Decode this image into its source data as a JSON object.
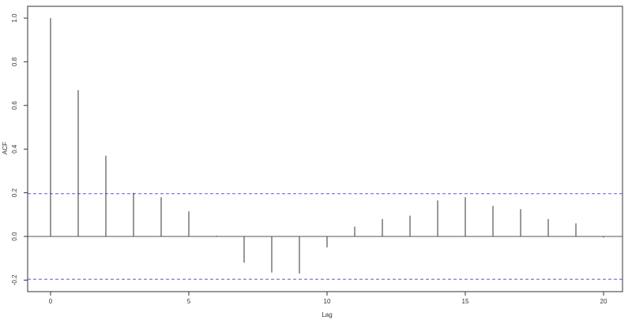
{
  "chart_data": {
    "type": "bar",
    "xlabel": "Lag",
    "ylabel": "ACF",
    "xlim": [
      -0.5,
      20.5
    ],
    "ylim": [
      -0.21,
      1.03
    ],
    "x": [
      0,
      1,
      2,
      3,
      4,
      5,
      6,
      7,
      8,
      9,
      10,
      11,
      12,
      13,
      14,
      15,
      16,
      17,
      18,
      19,
      20
    ],
    "values": [
      1.0,
      0.67,
      0.37,
      0.2,
      0.18,
      0.115,
      0.003,
      -0.12,
      -0.165,
      -0.17,
      -0.05,
      0.045,
      0.08,
      0.095,
      0.165,
      0.18,
      0.14,
      0.125,
      0.08,
      0.06,
      -0.005
    ],
    "x_ticks": [
      {
        "value": 0,
        "label": "0"
      },
      {
        "value": 5,
        "label": "5"
      },
      {
        "value": 10,
        "label": "10"
      },
      {
        "value": 15,
        "label": "15"
      },
      {
        "value": 20,
        "label": "20"
      }
    ],
    "y_ticks": [
      {
        "value": -0.2,
        "label": "-0.2"
      },
      {
        "value": 0.0,
        "label": "0.0"
      },
      {
        "value": 0.2,
        "label": "0.2"
      },
      {
        "value": 0.4,
        "label": "0.4"
      },
      {
        "value": 0.6,
        "label": "0.6"
      },
      {
        "value": 0.8,
        "label": "0.8"
      },
      {
        "value": 1.0,
        "label": "1.0"
      }
    ],
    "confidence_bounds": [
      0.196,
      -0.196
    ],
    "colors": {
      "bar": "#333333",
      "zero_line": "#555555",
      "bound": "#5b5bd6",
      "axis": "#333333"
    },
    "grid": false
  }
}
